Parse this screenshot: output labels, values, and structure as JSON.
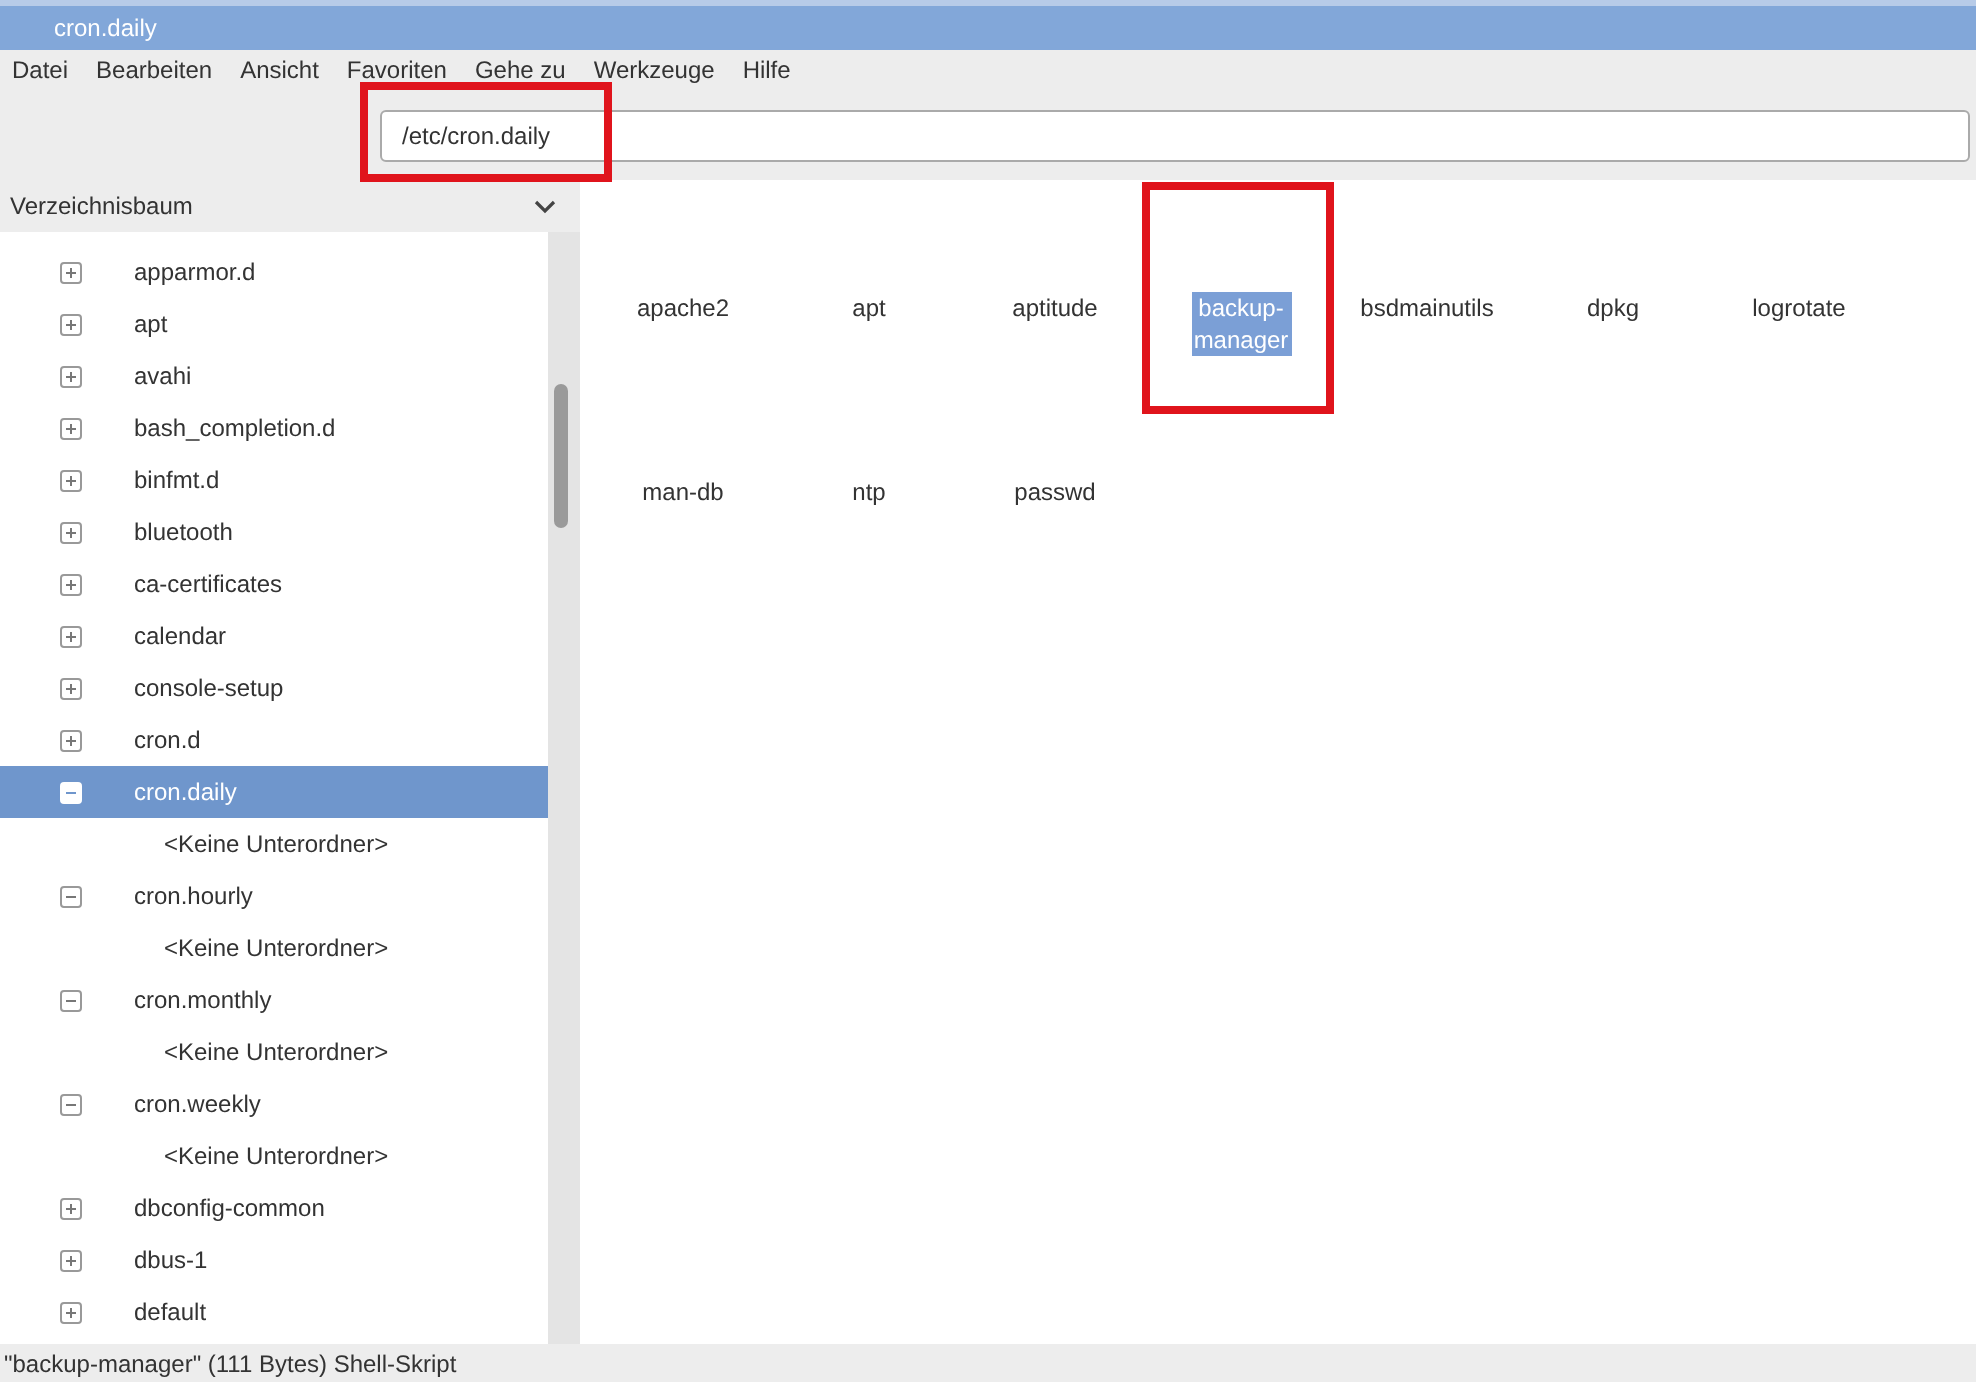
{
  "window": {
    "title": "cron.daily"
  },
  "menu": [
    "Datei",
    "Bearbeiten",
    "Ansicht",
    "Favoriten",
    "Gehe zu",
    "Werkzeuge",
    "Hilfe"
  ],
  "path_field": {
    "value": "/etc/cron.daily",
    "highlighted": true
  },
  "sidebar": {
    "title": "Verzeichnisbaum",
    "items": [
      {
        "label": "apparmor.d",
        "expanded": false,
        "selected": false
      },
      {
        "label": "apt",
        "expanded": false,
        "selected": false
      },
      {
        "label": "avahi",
        "expanded": false,
        "selected": false
      },
      {
        "label": "bash_completion.d",
        "expanded": false,
        "selected": false
      },
      {
        "label": "binfmt.d",
        "expanded": false,
        "selected": false
      },
      {
        "label": "bluetooth",
        "expanded": false,
        "selected": false
      },
      {
        "label": "ca-certificates",
        "expanded": false,
        "selected": false
      },
      {
        "label": "calendar",
        "expanded": false,
        "selected": false
      },
      {
        "label": "console-setup",
        "expanded": false,
        "selected": false
      },
      {
        "label": "cron.d",
        "expanded": false,
        "selected": false
      },
      {
        "label": "cron.daily",
        "expanded": true,
        "selected": true,
        "children": [
          {
            "label": "<Keine Unterordner>"
          }
        ]
      },
      {
        "label": "cron.hourly",
        "expanded": true,
        "selected": false,
        "children": [
          {
            "label": "<Keine Unterordner>"
          }
        ]
      },
      {
        "label": "cron.monthly",
        "expanded": true,
        "selected": false,
        "children": [
          {
            "label": "<Keine Unterordner>"
          }
        ]
      },
      {
        "label": "cron.weekly",
        "expanded": true,
        "selected": false,
        "children": [
          {
            "label": "<Keine Unterordner>"
          }
        ]
      },
      {
        "label": "dbconfig-common",
        "expanded": false,
        "selected": false
      },
      {
        "label": "dbus-1",
        "expanded": false,
        "selected": false
      },
      {
        "label": "default",
        "expanded": false,
        "selected": false
      }
    ]
  },
  "files": [
    {
      "name": "apache2",
      "selected": false,
      "highlighted": false
    },
    {
      "name": "apt",
      "selected": false,
      "highlighted": false
    },
    {
      "name": "aptitude",
      "selected": false,
      "highlighted": false
    },
    {
      "name": "backup-manager",
      "selected": true,
      "highlighted": true
    },
    {
      "name": "bsdmainutils",
      "selected": false,
      "highlighted": false
    },
    {
      "name": "dpkg",
      "selected": false,
      "highlighted": false
    },
    {
      "name": "logrotate",
      "selected": false,
      "highlighted": false
    },
    {
      "name": "man-db",
      "selected": false,
      "highlighted": false
    },
    {
      "name": "ntp",
      "selected": false,
      "highlighted": false
    },
    {
      "name": "passwd",
      "selected": false,
      "highlighted": false
    }
  ],
  "status_bar": "\"backup-manager\" (111 Bytes) Shell-Skript"
}
